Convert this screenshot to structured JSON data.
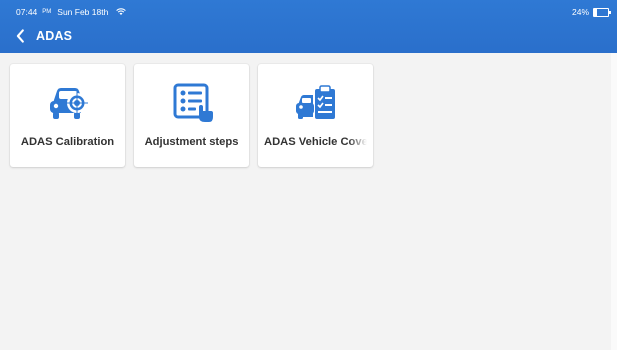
{
  "status": {
    "time": "07:44",
    "ampm": "PM",
    "date": "Sun Feb 18th",
    "battery": "24%",
    "battery_level": 0.24
  },
  "header": {
    "title": "ADAS"
  },
  "cards": [
    {
      "label": "ADAS Calibration",
      "icon": "car-target-icon"
    },
    {
      "label": "Adjustment steps",
      "icon": "checklist-icon"
    },
    {
      "label": "ADAS Vehicle Cove",
      "icon": "car-clipboard-icon"
    }
  ],
  "colors": {
    "topbar": "#2f79d4",
    "icon_blue": "#2f79d4",
    "background": "#f3f3f3"
  }
}
